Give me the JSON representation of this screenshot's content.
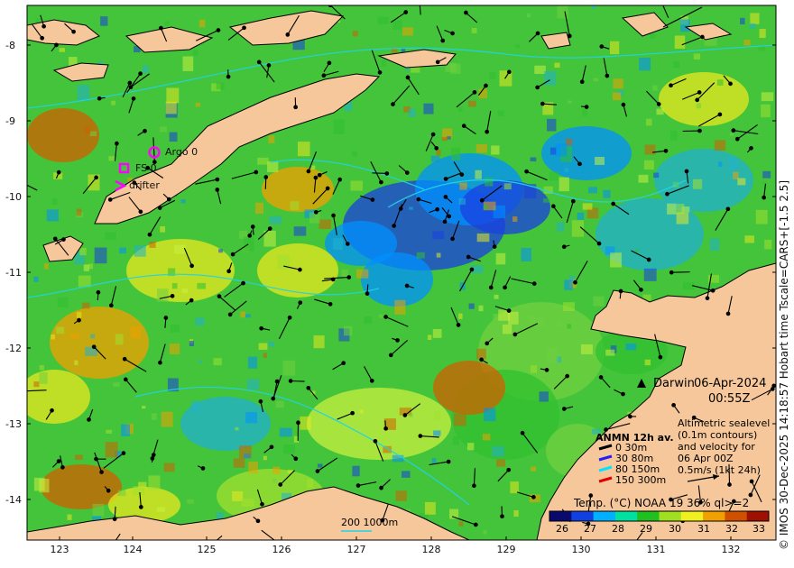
{
  "map": {
    "lat_ticks": [
      "-8",
      "-9",
      "-10",
      "-11",
      "-12",
      "-13",
      "-14"
    ],
    "lon_ticks": [
      "123",
      "124",
      "125",
      "126",
      "127",
      "128",
      "129",
      "130",
      "131",
      "132"
    ],
    "lon_range": [
      122.6,
      132.9
    ],
    "lat_range": [
      -7.6,
      -14.5
    ],
    "colors": {
      "land": "#f5c79a",
      "contour": "#22d3e6",
      "coast": "#000000"
    }
  },
  "markers": {
    "argo": {
      "label": "Argo 0",
      "color": "#ff00ff"
    },
    "fs": {
      "label": "FS 0",
      "color": "#ff00ff"
    },
    "drifter": {
      "label": "drifter",
      "color": "#ff00ff"
    }
  },
  "place": {
    "name": "Darwin"
  },
  "datetime": {
    "date": "06-Apr-2024",
    "time": "00:55Z"
  },
  "altimetry_note": [
    "Altimetric sealevel",
    "(0.1m contours)",
    "and velocity for",
    "06 Apr 00Z",
    "0.5m/s (1kt 24h)"
  ],
  "anmn": {
    "title": "ANMN 12h av.",
    "items": [
      {
        "label": "0 30m",
        "color": "#000000"
      },
      {
        "label": "30 80m",
        "color": "#2020ff"
      },
      {
        "label": "80 150m",
        "color": "#00e5ff"
      },
      {
        "label": "150 300m",
        "color": "#e00000"
      }
    ]
  },
  "depth_label": "200  1000m",
  "colorbar": {
    "title": "Temp. (°C) NOAA 19 36% ql>=2",
    "ticks": [
      "26",
      "27",
      "28",
      "29",
      "30",
      "31",
      "32",
      "33"
    ],
    "colors": [
      "#0a0a6e",
      "#1040e0",
      "#00b0ff",
      "#00e0a0",
      "#20c020",
      "#a0e020",
      "#f0f020",
      "#f0a000",
      "#d05000",
      "#a01000"
    ]
  },
  "side_note": "© IMOS 30-Dec-2025 14:18:57 Hobart time Tscale=CARS+[-1.5 2.5]"
}
